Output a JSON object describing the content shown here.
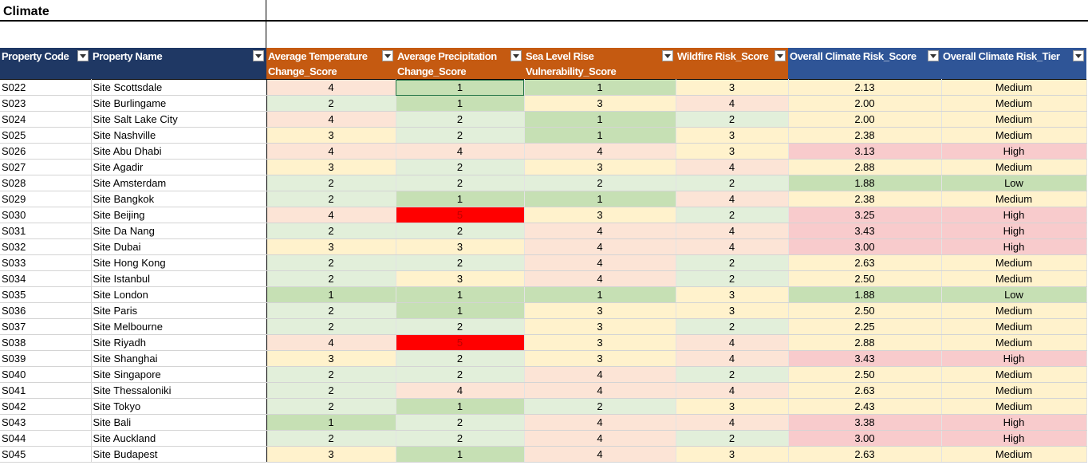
{
  "sheet": {
    "title": "Climate"
  },
  "headers": {
    "code": "Property Code",
    "name": "Property Name",
    "temp_line1": "Average Temperature",
    "temp_line2": "Change_Score",
    "precip_line1": "Average Precipitation",
    "precip_line2": "Change_Score",
    "sea_line1": "Sea Level Rise",
    "sea_line2": "Vulnerability_Score",
    "wildfire": "Wildfire Risk_Score",
    "overall_score": "Overall Climate Risk_Score",
    "overall_tier": "Overall Climate Risk_Tier"
  },
  "rows": [
    {
      "code": "S022",
      "name": "Site Scottsdale",
      "temp": "4",
      "precip": "1",
      "sea": "1",
      "fire": "3",
      "score": "2.13",
      "tier": "Medium"
    },
    {
      "code": "S023",
      "name": "Site Burlingame",
      "temp": "2",
      "precip": "1",
      "sea": "3",
      "fire": "4",
      "score": "2.00",
      "tier": "Medium"
    },
    {
      "code": "S024",
      "name": "Site Salt Lake City",
      "temp": "4",
      "precip": "2",
      "sea": "1",
      "fire": "2",
      "score": "2.00",
      "tier": "Medium"
    },
    {
      "code": "S025",
      "name": "Site Nashville",
      "temp": "3",
      "precip": "2",
      "sea": "1",
      "fire": "3",
      "score": "2.38",
      "tier": "Medium"
    },
    {
      "code": "S026",
      "name": "Site Abu Dhabi",
      "temp": "4",
      "precip": "4",
      "sea": "4",
      "fire": "3",
      "score": "3.13",
      "tier": "High"
    },
    {
      "code": "S027",
      "name": "Site Agadir",
      "temp": "3",
      "precip": "2",
      "sea": "3",
      "fire": "4",
      "score": "2.88",
      "tier": "Medium"
    },
    {
      "code": "S028",
      "name": "Site Amsterdam",
      "temp": "2",
      "precip": "2",
      "sea": "2",
      "fire": "2",
      "score": "1.88",
      "tier": "Low"
    },
    {
      "code": "S029",
      "name": "Site Bangkok",
      "temp": "2",
      "precip": "1",
      "sea": "1",
      "fire": "4",
      "score": "2.38",
      "tier": "Medium"
    },
    {
      "code": "S030",
      "name": "Site Beijing",
      "temp": "4",
      "precip": "5",
      "sea": "3",
      "fire": "2",
      "score": "3.25",
      "tier": "High"
    },
    {
      "code": "S031",
      "name": "Site Da Nang",
      "temp": "2",
      "precip": "2",
      "sea": "4",
      "fire": "4",
      "score": "3.43",
      "tier": "High"
    },
    {
      "code": "S032",
      "name": "Site Dubai",
      "temp": "3",
      "precip": "3",
      "sea": "4",
      "fire": "4",
      "score": "3.00",
      "tier": "High"
    },
    {
      "code": "S033",
      "name": "Site Hong Kong",
      "temp": "2",
      "precip": "2",
      "sea": "4",
      "fire": "2",
      "score": "2.63",
      "tier": "Medium"
    },
    {
      "code": "S034",
      "name": "Site Istanbul",
      "temp": "2",
      "precip": "3",
      "sea": "4",
      "fire": "2",
      "score": "2.50",
      "tier": "Medium"
    },
    {
      "code": "S035",
      "name": "Site London",
      "temp": "1",
      "precip": "1",
      "sea": "1",
      "fire": "3",
      "score": "1.88",
      "tier": "Low"
    },
    {
      "code": "S036",
      "name": "Site Paris",
      "temp": "2",
      "precip": "1",
      "sea": "3",
      "fire": "3",
      "score": "2.50",
      "tier": "Medium"
    },
    {
      "code": "S037",
      "name": "Site Melbourne",
      "temp": "2",
      "precip": "2",
      "sea": "3",
      "fire": "2",
      "score": "2.25",
      "tier": "Medium"
    },
    {
      "code": "S038",
      "name": "Site Riyadh",
      "temp": "4",
      "precip": "5",
      "sea": "3",
      "fire": "4",
      "score": "2.88",
      "tier": "Medium"
    },
    {
      "code": "S039",
      "name": "Site Shanghai",
      "temp": "3",
      "precip": "2",
      "sea": "3",
      "fire": "4",
      "score": "3.43",
      "tier": "High"
    },
    {
      "code": "S040",
      "name": "Site Singapore",
      "temp": "2",
      "precip": "2",
      "sea": "4",
      "fire": "2",
      "score": "2.50",
      "tier": "Medium"
    },
    {
      "code": "S041",
      "name": "Site Thessaloniki",
      "temp": "2",
      "precip": "4",
      "sea": "4",
      "fire": "4",
      "score": "2.63",
      "tier": "Medium"
    },
    {
      "code": "S042",
      "name": "Site Tokyo",
      "temp": "2",
      "precip": "1",
      "sea": "2",
      "fire": "3",
      "score": "2.43",
      "tier": "Medium"
    },
    {
      "code": "S043",
      "name": "Site Bali",
      "temp": "1",
      "precip": "2",
      "sea": "4",
      "fire": "4",
      "score": "3.38",
      "tier": "High"
    },
    {
      "code": "S044",
      "name": "Site Auckland",
      "temp": "2",
      "precip": "2",
      "sea": "4",
      "fire": "2",
      "score": "3.00",
      "tier": "High"
    },
    {
      "code": "S045",
      "name": "Site Budapest",
      "temp": "3",
      "precip": "1",
      "sea": "4",
      "fire": "3",
      "score": "2.63",
      "tier": "Medium"
    }
  ]
}
